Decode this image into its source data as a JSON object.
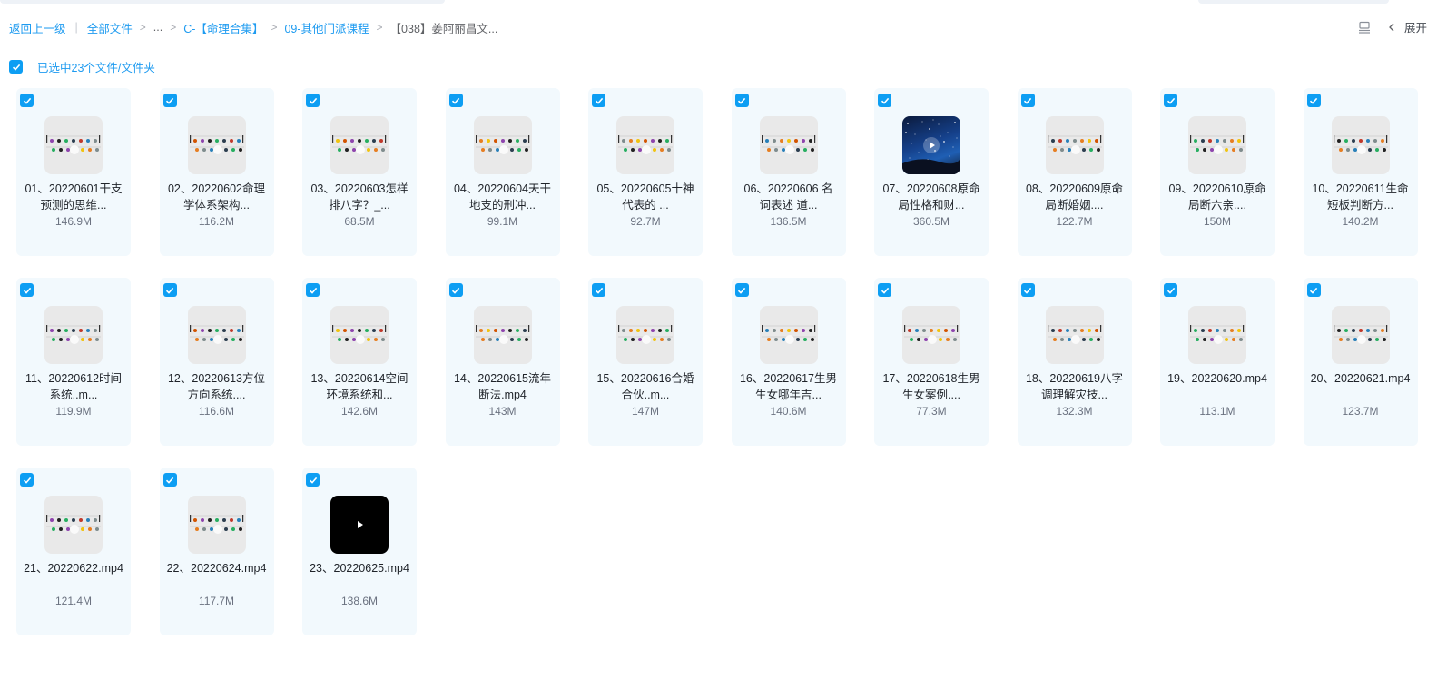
{
  "breadcrumb": {
    "back": "返回上一级",
    "all_files": "全部文件",
    "ellipsis": "...",
    "level1": "C-【命理合集】",
    "level2": "09-其他门派课程",
    "current": "【038】姜阿丽昌文..."
  },
  "toolbar": {
    "list_view_icon": "list-view-icon",
    "expand_label": "展开"
  },
  "selection": {
    "text": "已选中23个文件/文件夹",
    "checked": true
  },
  "files": [
    {
      "name": "01、20220601干支预测的思维...",
      "size": "146.9M",
      "thumb": "video-frame"
    },
    {
      "name": "02、20220602命理学体系架构...",
      "size": "116.2M",
      "thumb": "video-frame"
    },
    {
      "name": "03、20220603怎样排八字？_...",
      "size": "68.5M",
      "thumb": "video-frame"
    },
    {
      "name": "04、20220604天干地支的刑冲...",
      "size": "99.1M",
      "thumb": "video-frame"
    },
    {
      "name": "05、20220605十神代表的 ...",
      "size": "92.7M",
      "thumb": "video-frame"
    },
    {
      "name": "06、20220606 名词表述 道...",
      "size": "136.5M",
      "thumb": "video-frame"
    },
    {
      "name": "07、20220608原命局性格和财...",
      "size": "360.5M",
      "thumb": "space"
    },
    {
      "name": "08、20220609原命局断婚姻....",
      "size": "122.7M",
      "thumb": "video-frame"
    },
    {
      "name": "09、20220610原命局断六亲....",
      "size": "150M",
      "thumb": "video-frame"
    },
    {
      "name": "10、20220611生命短板判断方...",
      "size": "140.2M",
      "thumb": "video-frame"
    },
    {
      "name": "11、20220612时间系统..m...",
      "size": "119.9M",
      "thumb": "video-frame"
    },
    {
      "name": "12、20220613方位方向系统....",
      "size": "116.6M",
      "thumb": "video-frame"
    },
    {
      "name": "13、20220614空间环境系统和...",
      "size": "142.6M",
      "thumb": "video-frame"
    },
    {
      "name": "14、20220615流年断法.mp4",
      "size": "143M",
      "thumb": "video-frame"
    },
    {
      "name": "15、20220616合婚合伙..m...",
      "size": "147M",
      "thumb": "video-frame"
    },
    {
      "name": "16、20220617生男生女哪年吉...",
      "size": "140.6M",
      "thumb": "video-frame"
    },
    {
      "name": "17、20220618生男生女案例....",
      "size": "77.3M",
      "thumb": "video-frame"
    },
    {
      "name": "18、20220619八字调理解灾技...",
      "size": "132.3M",
      "thumb": "video-frame"
    },
    {
      "name": "19、20220620.mp4",
      "size": "113.1M",
      "thumb": "video-frame"
    },
    {
      "name": "20、20220621.mp4",
      "size": "123.7M",
      "thumb": "video-frame"
    },
    {
      "name": "21、20220622.mp4",
      "size": "121.4M",
      "thumb": "video-frame"
    },
    {
      "name": "22、20220624.mp4",
      "size": "117.7M",
      "thumb": "video-frame"
    },
    {
      "name": "23、20220625.mp4",
      "size": "138.6M",
      "thumb": "black"
    }
  ],
  "colors": {
    "accent": "#1e9bf0",
    "checkbox": "#0d9ef3",
    "card_bg": "#f2f9fd",
    "thumb_bg": "#e9e9e9"
  }
}
